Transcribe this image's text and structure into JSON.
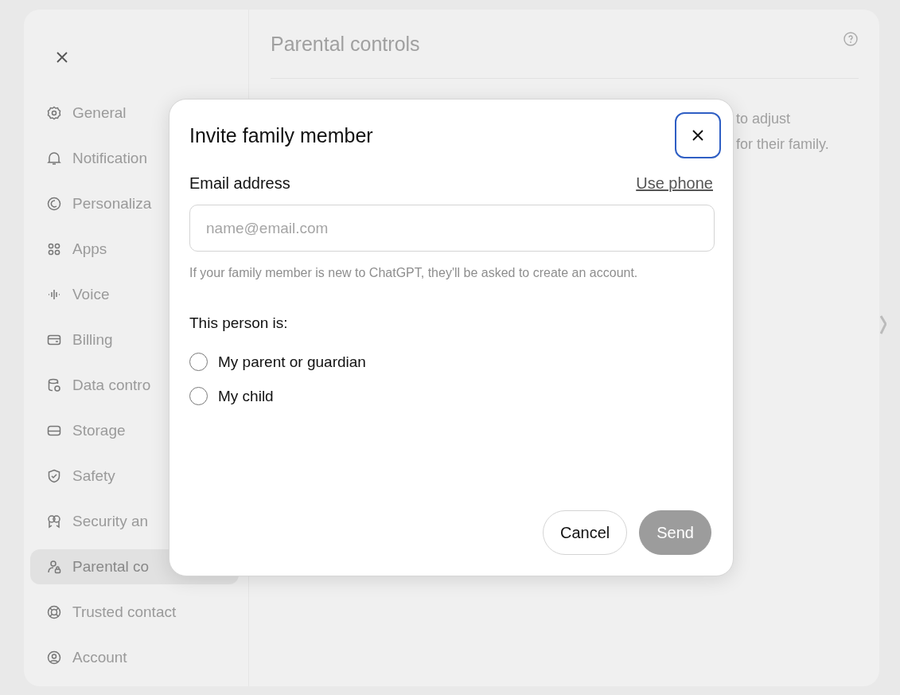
{
  "sidebar": {
    "items": [
      {
        "label": "General",
        "selected": false
      },
      {
        "label": "Notification",
        "selected": false
      },
      {
        "label": "Personaliza",
        "selected": false
      },
      {
        "label": "Apps",
        "selected": false
      },
      {
        "label": "Voice",
        "selected": false
      },
      {
        "label": "Billing",
        "selected": false
      },
      {
        "label": "Data contro",
        "selected": false
      },
      {
        "label": "Storage",
        "selected": false
      },
      {
        "label": "Safety",
        "selected": false
      },
      {
        "label": "Security an",
        "selected": false
      },
      {
        "label": "Parental co",
        "selected": true
      },
      {
        "label": "Trusted contact",
        "selected": false
      },
      {
        "label": "Account",
        "selected": false
      }
    ]
  },
  "content": {
    "title": "Parental controls",
    "description_lines": [
      "to adjust",
      "for their family."
    ]
  },
  "dialog": {
    "title": "Invite family member",
    "email_label": "Email address",
    "use_phone": "Use phone",
    "email_placeholder": "name@email.com",
    "hint": "If your family member is new to ChatGPT, they'll be asked to create an account.",
    "question": "This person is:",
    "options": [
      {
        "label": "My parent or guardian",
        "selected": false
      },
      {
        "label": "My child",
        "selected": false
      }
    ],
    "buttons": [
      {
        "label": "Cancel",
        "disabled": false
      },
      {
        "label": "Send",
        "disabled": true
      }
    ]
  }
}
